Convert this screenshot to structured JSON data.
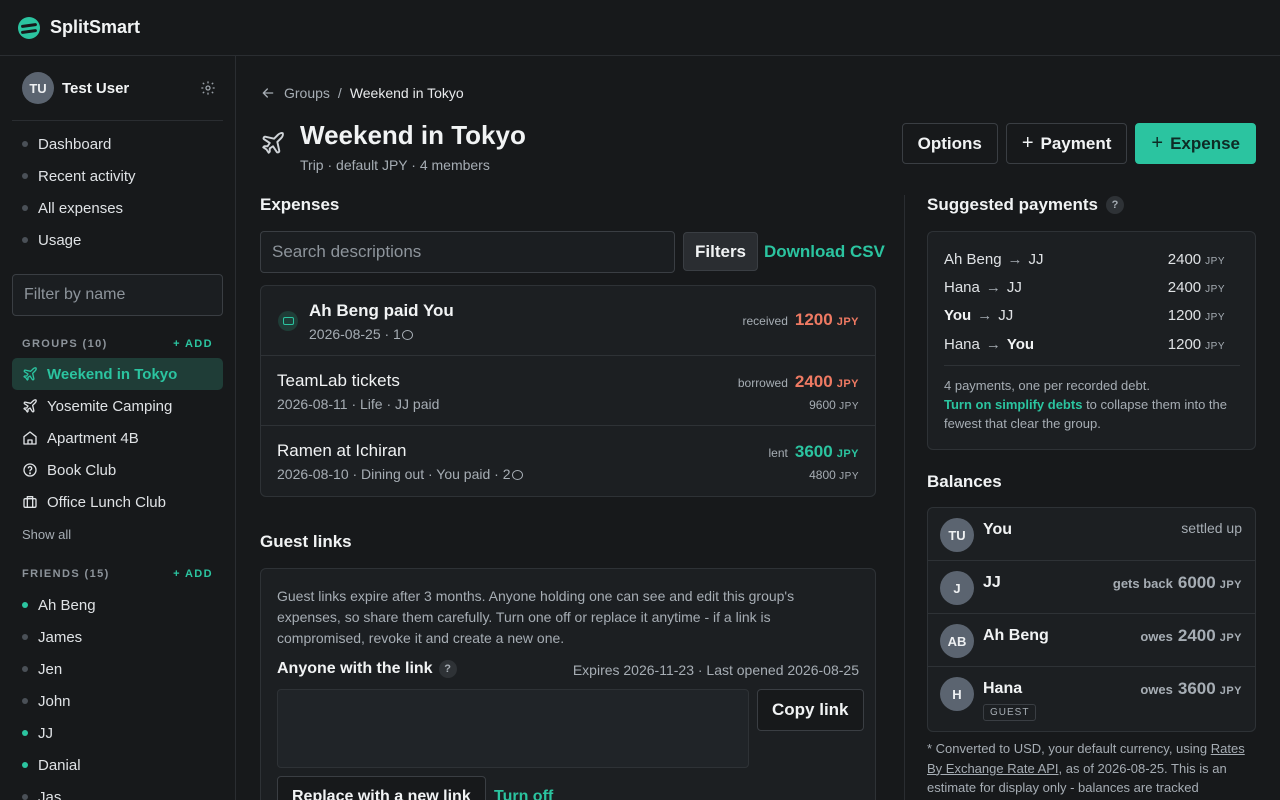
{
  "app": {
    "name": "SplitSmart"
  },
  "user": {
    "initials": "TU",
    "name": "Test User"
  },
  "nav": [
    "Dashboard",
    "Recent activity",
    "All expenses",
    "Usage"
  ],
  "filter_placeholder": "Filter by name",
  "groups": {
    "heading": "GROUPS (10)",
    "add": "+ ADD",
    "items": [
      {
        "label": "Weekend in Tokyo",
        "icon": "plane-icon",
        "active": true
      },
      {
        "label": "Yosemite Camping",
        "icon": "plane-icon"
      },
      {
        "label": "Apartment 4B",
        "icon": "home-icon"
      },
      {
        "label": "Book Club",
        "icon": "question-circle-icon"
      },
      {
        "label": "Office Lunch Club",
        "icon": "briefcase-icon"
      }
    ],
    "show_all": "Show all"
  },
  "friends": {
    "heading": "FRIENDS (15)",
    "add": "+ ADD",
    "items": [
      {
        "label": "Ah Beng",
        "active": true
      },
      {
        "label": "James",
        "active": false
      },
      {
        "label": "Jen",
        "active": false
      },
      {
        "label": "John",
        "active": false
      },
      {
        "label": "JJ",
        "active": true
      },
      {
        "label": "Danial",
        "active": true
      },
      {
        "label": "Jas",
        "active": false
      }
    ]
  },
  "breadcrumb": {
    "parent": "Groups",
    "sep": "/",
    "current": "Weekend in Tokyo"
  },
  "group": {
    "title": "Weekend in Tokyo",
    "subtitle": "Trip · default JPY · 4 members"
  },
  "actions": {
    "options": "Options",
    "payment": "Payment",
    "expense": "Expense",
    "plus": "+"
  },
  "expenses": {
    "heading": "Expenses",
    "search_placeholder": "Search descriptions",
    "filters": "Filters",
    "download": "Download CSV",
    "items": [
      {
        "title": "Ah Beng paid You",
        "sub": "2026-08-25 · 1",
        "kind": "received",
        "amount": "1200",
        "currency": "JPY",
        "color": "#ef7a63"
      },
      {
        "title": "TeamLab tickets",
        "sub": "2026-08-11 · Life · JJ paid",
        "kind": "borrowed",
        "amount": "2400",
        "currency": "JPY",
        "total": "9600",
        "color": "#ef7a63"
      },
      {
        "title": "Ramen at Ichiran",
        "sub": "2026-08-10 · Dining out · You paid · 2",
        "kind": "lent",
        "amount": "3600",
        "currency": "JPY",
        "total": "4800",
        "color": "#2bc4a0"
      }
    ]
  },
  "guest_links": {
    "heading": "Guest links",
    "description": "Guest links expire after 3 months. Anyone holding one can see and edit this group's expenses, so share them carefully. Turn one off or replace it anytime - if a link is compromised, revoke it and create a new one.",
    "anyone_label": "Anyone with the link",
    "help": "?",
    "expiry": "Expires 2026-11-23 · Last opened 2026-08-25",
    "copy": "Copy link",
    "replace": "Replace with a new link",
    "turn_off": "Turn off"
  },
  "suggested": {
    "heading": "Suggested payments",
    "help": "?",
    "payments": [
      {
        "from": "Ah Beng",
        "to": "JJ",
        "amount": "2400",
        "currency": "JPY",
        "arrow": "→"
      },
      {
        "from": "Hana",
        "to": "JJ",
        "amount": "2400",
        "currency": "JPY",
        "arrow": "→"
      },
      {
        "from": "You",
        "to": "JJ",
        "amount": "1200",
        "currency": "JPY",
        "arrow": "→"
      },
      {
        "from": "Hana",
        "to": "You",
        "amount": "1200",
        "currency": "JPY",
        "arrow": "→"
      }
    ],
    "note_1": "4 payments, one per recorded debt.",
    "note_link": "Turn on simplify debts",
    "note_2": "to collapse them into the fewest that clear the group."
  },
  "balances": {
    "heading": "Balances",
    "items": [
      {
        "initials": "TU",
        "name": "You",
        "status": "settled up"
      },
      {
        "initials": "J",
        "name": "JJ",
        "label": "gets back",
        "amount": "6000",
        "currency": "JPY",
        "color": "#2bc4a0"
      },
      {
        "initials": "AB",
        "name": "Ah Beng",
        "label": "owes",
        "amount": "2400",
        "currency": "JPY",
        "color": "#ef7a63"
      },
      {
        "initials": "H",
        "name": "Hana",
        "label": "owes",
        "amount": "3600",
        "currency": "JPY",
        "color": "#ef7a63",
        "tag": "GUEST"
      }
    ]
  },
  "footnote": {
    "pre": "* Converted to USD, your default currency, using",
    "link": "Rates By Exchange Rate API",
    "post": ", as of 2026-08-25. This is an estimate for display only - balances are tracked"
  },
  "colors": {
    "accent": "#2bc4a0",
    "negative": "#ef7a63",
    "bg": "#17191b",
    "panel": "#1c1f22"
  }
}
